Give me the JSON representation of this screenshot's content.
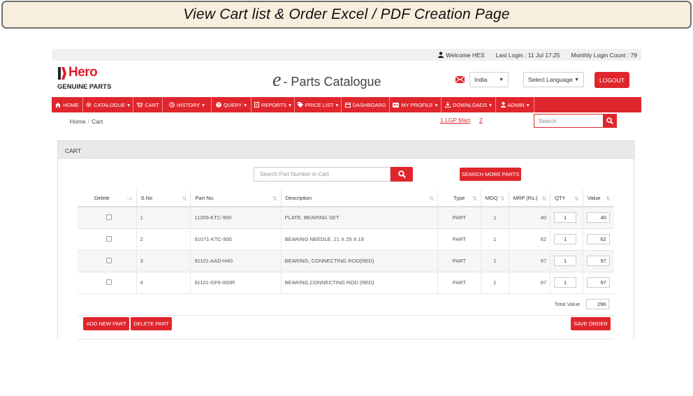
{
  "banner": {
    "title": "View Cart list & Order Excel / PDF Creation Page"
  },
  "topbar": {
    "welcome": "Welcome HES",
    "last_login": "Last Login : 11 Jul 17:25",
    "monthly_count": "Monthly Login Count : 79"
  },
  "header": {
    "brand": "Hero",
    "brand_sub": "GENUINE PARTS",
    "title_e": "e",
    "title_rest": "- Parts Catalogue",
    "country_select": "India",
    "language_select": "Select Language",
    "logout": "LOGOUT"
  },
  "nav": {
    "items": [
      {
        "label": "HOME",
        "icon": "home-icon",
        "caret": ""
      },
      {
        "label": "CATALOGUE",
        "icon": "gear-icon",
        "caret": "▾"
      },
      {
        "label": "CART",
        "icon": "cart-icon",
        "caret": ""
      },
      {
        "label": "HISTORY",
        "icon": "history-icon",
        "caret": "▾"
      },
      {
        "label": "QUERY",
        "icon": "question-icon",
        "caret": "▾"
      },
      {
        "label": "REPORTS",
        "icon": "report-icon",
        "caret": "▾"
      },
      {
        "label": "PRICE LIST",
        "icon": "tag-icon",
        "caret": "▾"
      },
      {
        "label": "DASHBOARD",
        "icon": "dashboard-icon",
        "caret": ""
      },
      {
        "label": "MY PROFILE",
        "icon": "profile-icon",
        "caret": "▾"
      },
      {
        "label": "DOWNLOADS",
        "icon": "download-icon",
        "caret": "▾"
      },
      {
        "label": "ADMIN",
        "icon": "user-icon",
        "caret": "▾"
      }
    ]
  },
  "breadcrumb": {
    "home": "Home",
    "sep": "/",
    "current": "Cart"
  },
  "lgp": {
    "mart": "1 LGP Mart",
    "count": "2"
  },
  "search": {
    "placeholder": "Search"
  },
  "panel": {
    "heading": "CART",
    "search_placeholder": "Search Part Number in Cart",
    "search_more": "SEARCH MORE PARTS"
  },
  "table": {
    "headers": [
      "Delete",
      "S.No",
      "Part No.",
      "Description",
      "Type",
      "MOQ",
      "MRP (Rs.)",
      "QTY",
      "Value"
    ],
    "rows": [
      {
        "sno": "1",
        "part": "11209-KTC-900",
        "desc": "PLATE, BEARING SET",
        "type": "PART",
        "moq": "1",
        "mrp": "40",
        "qty": "1",
        "value": "40"
      },
      {
        "sno": "2",
        "part": "91071-KTC-900",
        "desc": "BEARING NEEDLE, 21 X 25 X 18",
        "type": "PART",
        "moq": "1",
        "mrp": "62",
        "qty": "1",
        "value": "62"
      },
      {
        "sno": "3",
        "part": "91101-AAD-H40",
        "desc": "BEARING, CONNECTING ROD(RED)",
        "type": "PART",
        "moq": "1",
        "mrp": "97",
        "qty": "1",
        "value": "97"
      },
      {
        "sno": "4",
        "part": "91101-GF6-000R",
        "desc": "BEARING,CONNECTING ROD (RED)",
        "type": "PART",
        "moq": "1",
        "mrp": "97",
        "qty": "1",
        "value": "97"
      }
    ],
    "total_label": "Total Value",
    "total_value": "296"
  },
  "actions": {
    "add": "ADD NEW PART",
    "delete": "DELETE PART",
    "save": "SAVE ORDER"
  },
  "colors": {
    "accent": "#e0262d",
    "banner_bg": "#f7eede"
  }
}
